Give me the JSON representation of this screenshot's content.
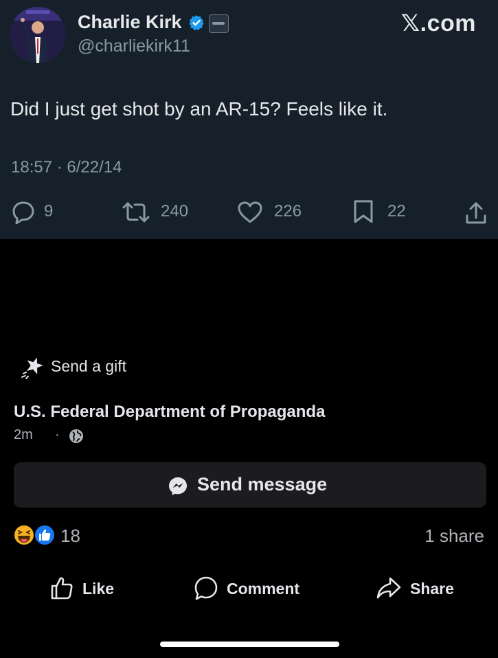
{
  "tweet": {
    "author_name": "Charlie Kirk",
    "author_handle": "@charliekirk11",
    "site": "𝕏.com",
    "text": "Did I just get shot by an AR-15? Feels like it.",
    "timestamp": "18:57 · 6/22/14",
    "actions": [
      {
        "icon": "reply-icon",
        "count": "9"
      },
      {
        "icon": "retweet-icon",
        "count": "240"
      },
      {
        "icon": "like-heart-icon",
        "count": "226"
      },
      {
        "icon": "bookmark-icon",
        "count": "22"
      },
      {
        "icon": "share-upload-icon",
        "count": ""
      }
    ],
    "colors": {
      "background": "#15202b",
      "verified": "#1d9bf0",
      "muted": "#8b98a5"
    }
  },
  "post": {
    "gift_label": "Send a gift",
    "page_name": "U.S. Federal Department of Propaganda",
    "time": "2m",
    "separator": "·",
    "audience_icon": "globe-icon",
    "send_message_label": "Send message",
    "reaction_count": "18",
    "reaction_icons": [
      "haha-reaction-icon",
      "like-reaction-icon"
    ],
    "share_count": "1 share",
    "actions": {
      "like": "Like",
      "comment": "Comment",
      "share": "Share"
    },
    "colors": {
      "background": "#000000",
      "button": "#1c1c1e",
      "like_blue": "#1877f2",
      "haha_yellow": "#f7b125"
    }
  }
}
